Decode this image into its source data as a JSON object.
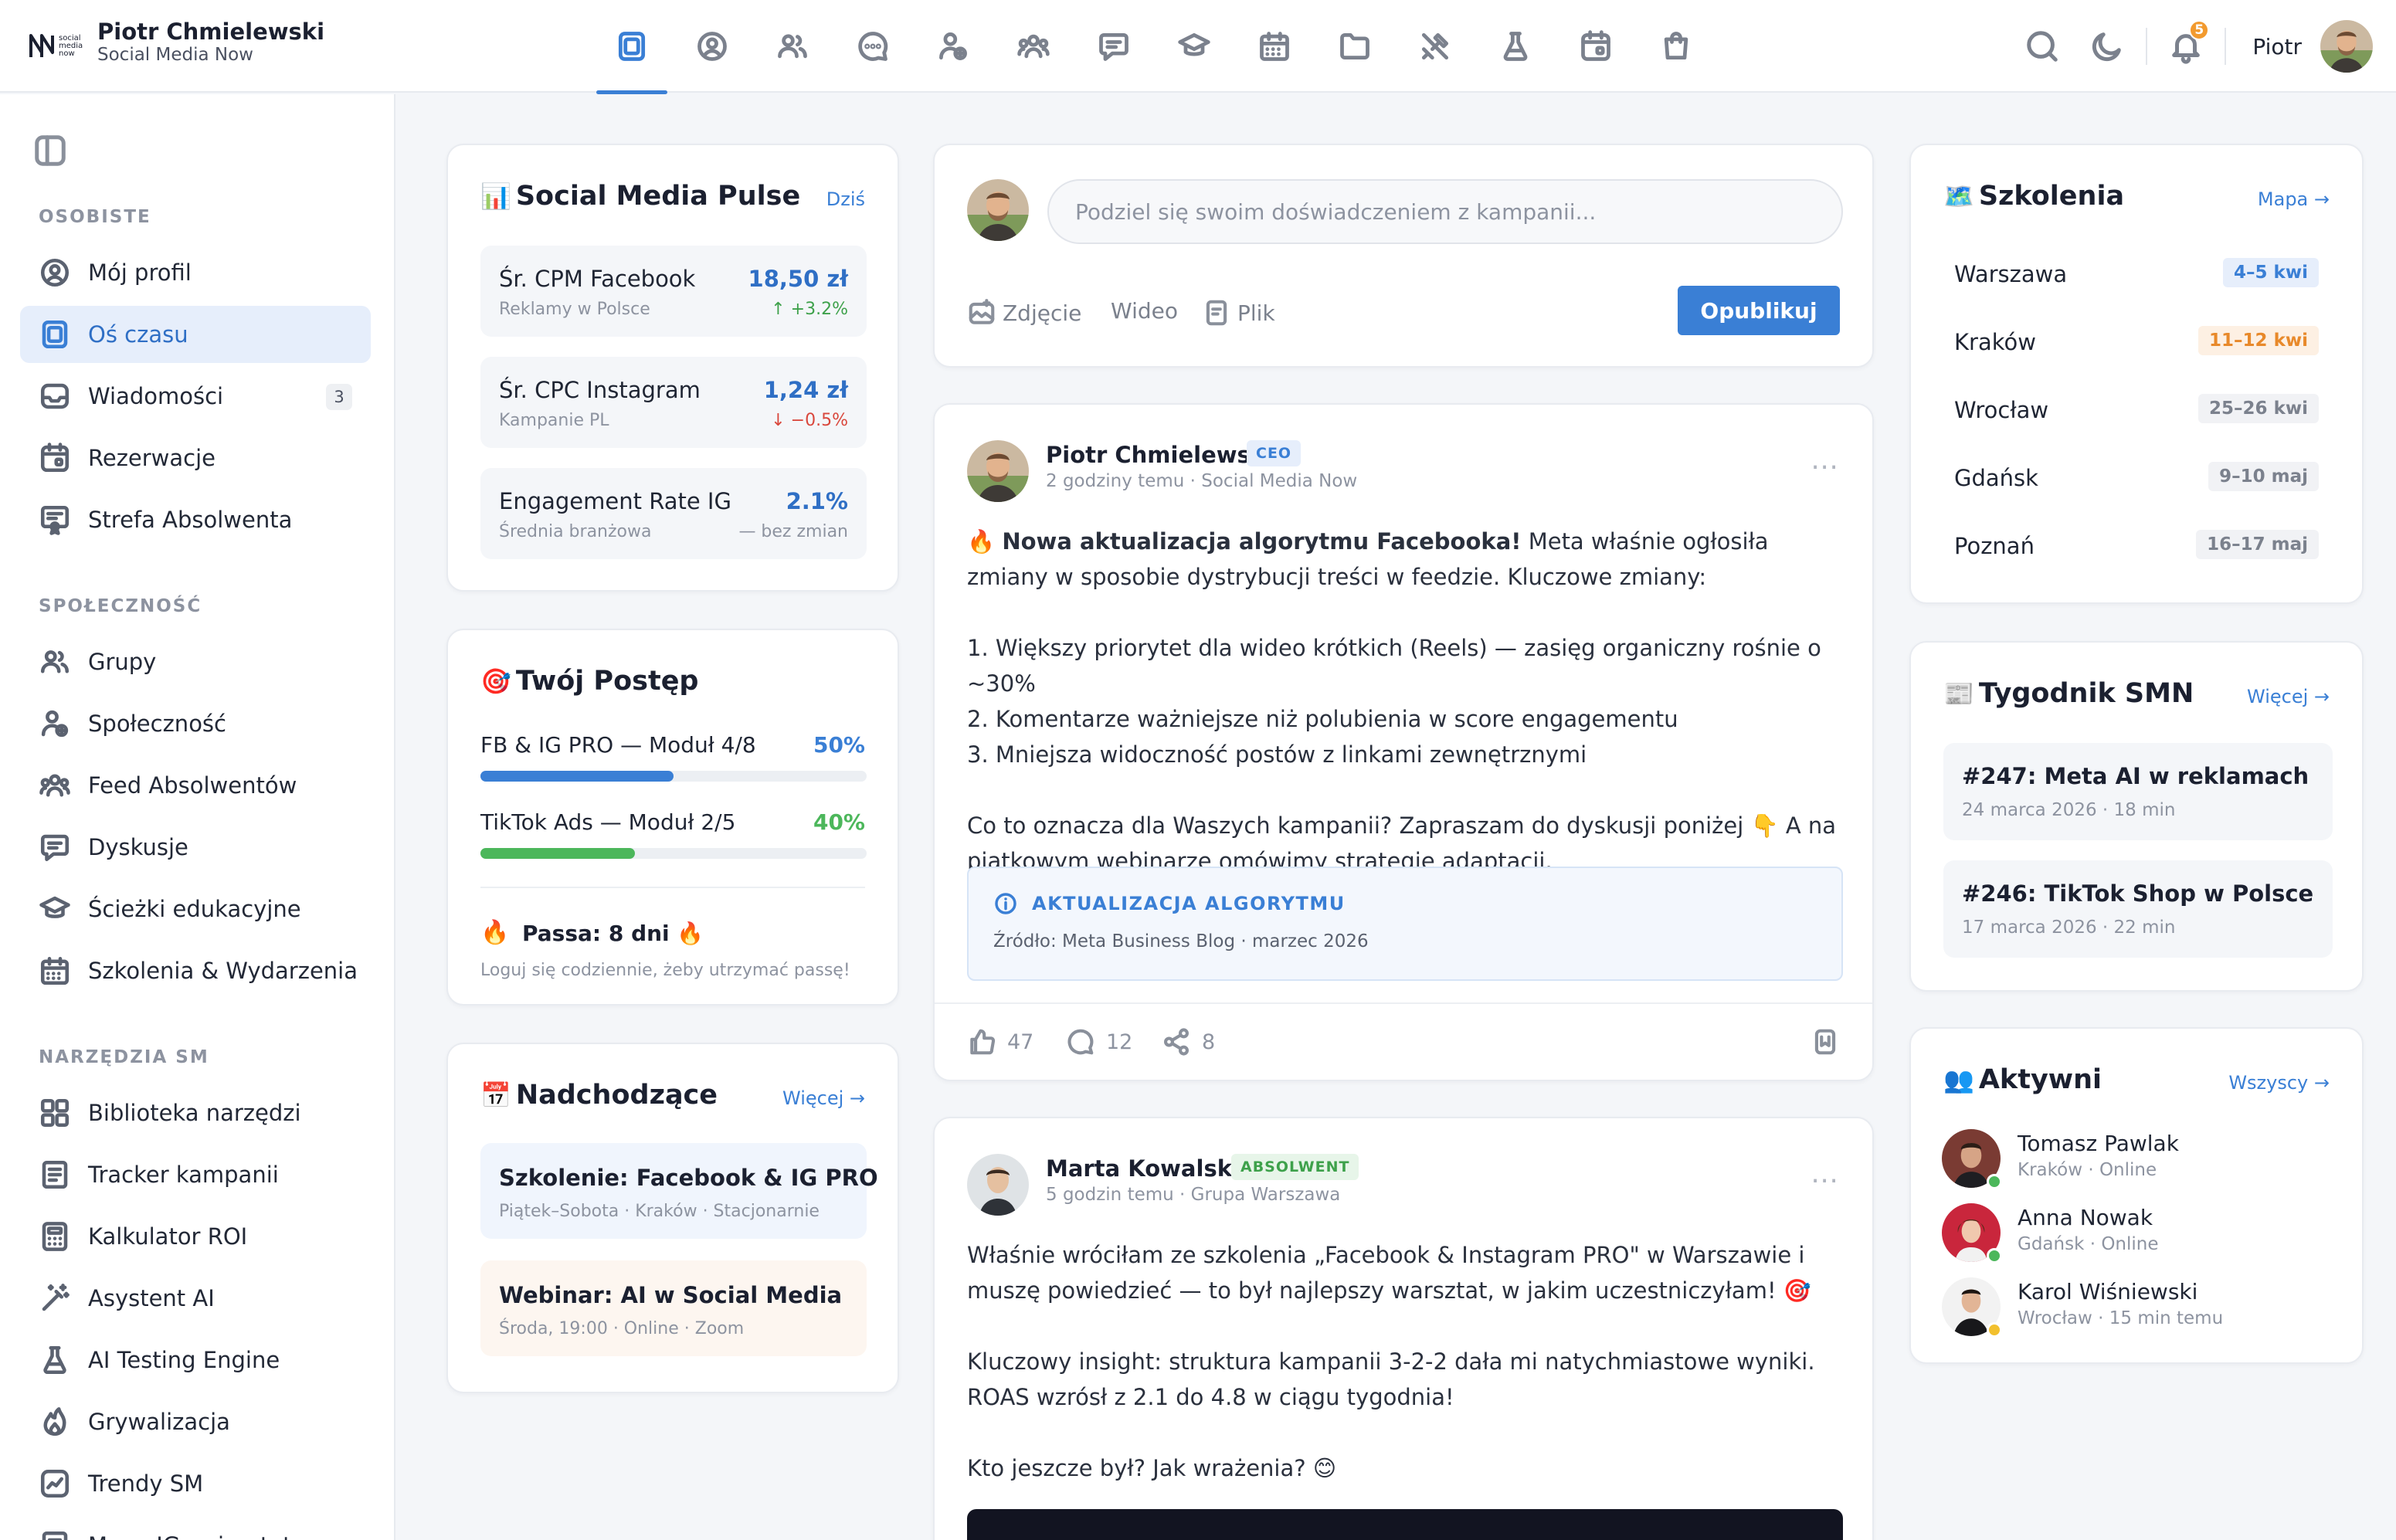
{
  "brand": {
    "name": "Piotr Chmielewski",
    "subtitle": "Social Media Now"
  },
  "topbar": {
    "user_name": "Piotr",
    "notifications": "5"
  },
  "sidebar": {
    "sections": [
      {
        "title": "OSOBISTE",
        "items": [
          {
            "label": "Mój profil"
          },
          {
            "label": "Oś czasu",
            "active": true
          },
          {
            "label": "Wiadomości",
            "count": "3"
          },
          {
            "label": "Rezerwacje"
          },
          {
            "label": "Strefa Absolwenta"
          }
        ]
      },
      {
        "title": "SPOŁECZNOŚĆ",
        "items": [
          {
            "label": "Grupy"
          },
          {
            "label": "Społeczność"
          },
          {
            "label": "Feed Absolwentów"
          },
          {
            "label": "Dyskusje"
          },
          {
            "label": "Ścieżki edukacyjne"
          },
          {
            "label": "Szkolenia & Wydarzenia"
          }
        ]
      },
      {
        "title": "NARZĘDZIA SM",
        "items": [
          {
            "label": "Biblioteka narzędzi"
          },
          {
            "label": "Tracker kampanii"
          },
          {
            "label": "Kalkulator ROI"
          },
          {
            "label": "Asystent AI"
          },
          {
            "label": "AI Testing Engine"
          },
          {
            "label": "Grywalizacja"
          },
          {
            "label": "Trendy SM"
          },
          {
            "label": "Mapa IG, priorytet"
          }
        ]
      }
    ]
  },
  "pulse": {
    "emoji": "📊",
    "title": "Social Media Pulse",
    "link": "Dziś",
    "metrics": [
      {
        "name": "Śr. CPM Facebook",
        "sub": "Reklamy w Polsce",
        "value": "18,50 zł",
        "change": "+3.2%",
        "trend": "up"
      },
      {
        "name": "Śr. CPC Instagram",
        "sub": "Kampanie PL",
        "value": "1,24 zł",
        "change": "−0.5%",
        "trend": "down"
      },
      {
        "name": "Engagement Rate IG",
        "sub": "Średnia branżowa",
        "value": "2.1%",
        "change": "— bez zmian",
        "trend": "flat"
      }
    ]
  },
  "progress": {
    "emoji": "🎯",
    "title": "Twój Postęp",
    "courses": [
      {
        "label": "FB & IG PRO — Moduł 4/8",
        "pct": "50%",
        "value": 0.5,
        "color": "#3a7fd5"
      },
      {
        "label": "TikTok Ads — Moduł 2/5",
        "pct": "40%",
        "value": 0.4,
        "color": "#4cb75b"
      }
    ],
    "streak_icon": "🔥",
    "streak": "Passa: 8 dni 🔥",
    "streak_sub": "Loguj się codziennie, żeby utrzymać passę!"
  },
  "upcoming": {
    "emoji": "📅",
    "title": "Nadchodzące",
    "link": "Więcej →",
    "events": [
      {
        "title": "Szkolenie: Facebook & IG PRO",
        "sub": "Piątek–Sobota · Kraków · Stacjonarnie"
      },
      {
        "title": "Webinar: AI w Social Media",
        "sub": "Środa, 19:00 · Online · Zoom"
      }
    ]
  },
  "composer": {
    "placeholder": "Podziel się swoim doświadczeniem z kampanii...",
    "photo": "Zdjęcie",
    "video": "Wideo",
    "file": "Plik",
    "publish": "Opublikuj"
  },
  "posts": [
    {
      "author": "Piotr Chmielewski",
      "badge": "CEO",
      "meta": "2 godziny temu · Social Media Now",
      "lead_emoji": "🔥",
      "lead_bold": "Nowa aktualizacja algorytmu Facebooka!",
      "lead_rest": " Meta właśnie ogłosiła zmiany w sposobie dystrybucji treści w feedzie. Kluczowe zmiany:",
      "lines": [
        "1. Większy priorytet dla wideo krótkich (Reels) — zasięg organiczny rośnie o ~30%",
        "2. Komentarze ważniejsze niż polubienia w score engagementu",
        "3. Mniejsza widoczność postów z linkami zewnętrznymi"
      ],
      "closing": "Co to oznacza dla Waszych kampanii? Zapraszam do dyskusji poniżej 👇 A na piątkowym webinarze omówimy strategie adaptacji.",
      "callout_title": "AKTUALIZACJA ALGORYTMU",
      "callout_sub": "Źródło: Meta Business Blog · marzec 2026",
      "likes": "47",
      "comments": "12",
      "shares": "8"
    },
    {
      "author": "Marta Kowalska",
      "badge": "ABSOLWENT",
      "meta": "5 godzin temu · Grupa Warszawa",
      "p1": "Właśnie wróciłam ze szkolenia „Facebook & Instagram PRO\" w Warszawie i muszę powiedzieć — to był najlepszy warsztat, w jakim uczestniczyłam! 🎯",
      "p2": "Kluczowy insight: struktura kampanii 3-2-2 dała mi natychmiastowe wyniki. ROAS wzrósł z 2.1 do 4.8 w ciągu tygodnia!",
      "p3": "Kto jeszcze był? Jak wrażenia? 😊"
    }
  ],
  "trainings": {
    "emoji": "🗺️",
    "title": "Szkolenia",
    "link": "Mapa →",
    "cities": [
      {
        "city": "Warszawa",
        "date": "4–5 kwi",
        "tone": "blue"
      },
      {
        "city": "Kraków",
        "date": "11–12 kwi",
        "tone": "orange"
      },
      {
        "city": "Wrocław",
        "date": "25–26 kwi",
        "tone": "gray"
      },
      {
        "city": "Gdańsk",
        "date": "9–10 maj",
        "tone": "gray"
      },
      {
        "city": "Poznań",
        "date": "16–17 maj",
        "tone": "gray"
      }
    ]
  },
  "weekly": {
    "emoji": "📰",
    "title": "Tygodnik SMN",
    "link": "Więcej →",
    "items": [
      {
        "title": "#247: Meta AI w reklamach",
        "sub": "24 marca 2026 · 18 min"
      },
      {
        "title": "#246: TikTok Shop w Polsce",
        "sub": "17 marca 2026 · 22 min"
      }
    ]
  },
  "active": {
    "emoji": "👥",
    "title": "Aktywni",
    "link": "Wszyscy →",
    "users": [
      {
        "name": "Tomasz Pawlak",
        "sub": "Kraków · Online",
        "status": "online"
      },
      {
        "name": "Anna Nowak",
        "sub": "Gdańsk · Online",
        "status": "online"
      },
      {
        "name": "Karol Wiśniewski",
        "sub": "Wrocław · 15 min temu",
        "status": "away"
      }
    ]
  },
  "colors": {
    "accent": "#3a7fd5",
    "success": "#4cb75b",
    "warning": "#f29a2e",
    "danger": "#d9473c"
  },
  "icons": {
    "topnav": [
      "timeline-icon",
      "profile-icon",
      "groups-icon",
      "chat-icon",
      "community-icon",
      "alumni-icon",
      "discussions-icon",
      "education-icon",
      "calendar-icon",
      "folder-icon",
      "tools-icon",
      "ai-icon",
      "bookings-icon",
      "shop-icon"
    ],
    "topbar": [
      "search-icon",
      "moon-icon",
      "bell-icon"
    ]
  }
}
